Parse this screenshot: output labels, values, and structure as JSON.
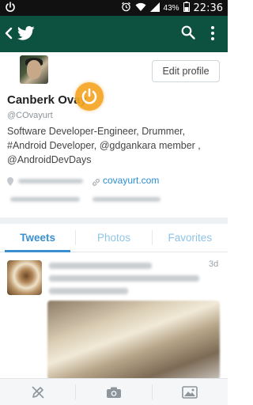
{
  "status_bar": {
    "battery_percent": "43%",
    "time": "22:36",
    "icons": [
      "power-icon",
      "alarm-icon",
      "wifi-icon",
      "signal-icon",
      "battery-icon"
    ]
  },
  "app_bar": {
    "icons": [
      "back-arrow-icon",
      "twitter-bird-icon",
      "search-icon",
      "overflow-menu-icon"
    ],
    "color": "#0d5240"
  },
  "profile": {
    "name": "Canberk Ovay",
    "handle": "@COvayurt",
    "bio": "Software Developer-Engineer, Drummer, #Android Developer, @gdgankara member , @AndroidDevDays",
    "website": "covayurt.com",
    "edit_button_label": "Edit profile",
    "overlay_icon": "power-icon",
    "overlay_color": "#f6a623"
  },
  "tabs": [
    {
      "label": "Tweets",
      "active": true
    },
    {
      "label": "Photos",
      "active": false
    },
    {
      "label": "Favorites",
      "active": false
    }
  ],
  "tweet": {
    "time": "3d"
  },
  "bottom_bar": {
    "items": [
      "compose-tweet-icon",
      "camera-icon",
      "gallery-icon"
    ]
  },
  "colors": {
    "accent": "#3a8fd0",
    "link": "#2b8dd1"
  }
}
